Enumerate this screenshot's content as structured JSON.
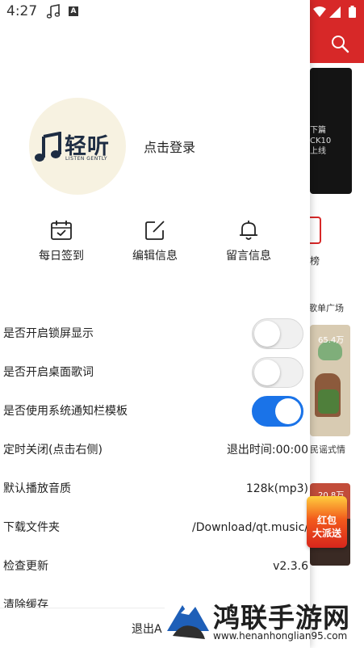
{
  "status_bar": {
    "time": "4:27",
    "notification_icons": [
      "music-note-icon",
      "a-icon"
    ],
    "a_glyph": "A"
  },
  "background_app": {
    "accent_color": "#d72828",
    "banner_lines": [
      "下篇",
      "CK10",
      "上线"
    ],
    "chart_label": "榜",
    "square_label": "歌单广场",
    "card1_count": "65.4万",
    "card1_caption": "民谣式情",
    "card2_count": "20.8万",
    "promo_lines": [
      "红包",
      "大派送"
    ]
  },
  "profile": {
    "logo_text": "轻听",
    "logo_subtext": "LISTEN GENTLY",
    "login_label": "点击登录"
  },
  "actions": [
    {
      "label": "每日签到",
      "icon": "calendar-check-icon"
    },
    {
      "label": "编辑信息",
      "icon": "edit-icon"
    },
    {
      "label": "留言信息",
      "icon": "bell-icon"
    }
  ],
  "settings": [
    {
      "label": "是否开启锁屏显示",
      "toggle": false
    },
    {
      "label": "是否开启桌面歌词",
      "toggle": false
    },
    {
      "label": "是否使用系统通知栏模板",
      "toggle": true
    },
    {
      "label": "定时关闭(点击右侧)",
      "value": "退出时间:00:00"
    },
    {
      "label": "默认播放音质",
      "value": "128k(mp3)"
    },
    {
      "label": "下载文件夹",
      "value": "/Download/qt.music/"
    },
    {
      "label": "检查更新",
      "value": "v2.3.6"
    },
    {
      "label": "清除缓存"
    }
  ],
  "logout_label": "退出A",
  "watermark": {
    "title": "鸿联手游网",
    "url": "www.henanhonglian95.com"
  },
  "colors": {
    "toggle_on": "#1a73e8",
    "logo_navy": "#1e2d43",
    "avatar_bg": "#f7f2e1"
  }
}
